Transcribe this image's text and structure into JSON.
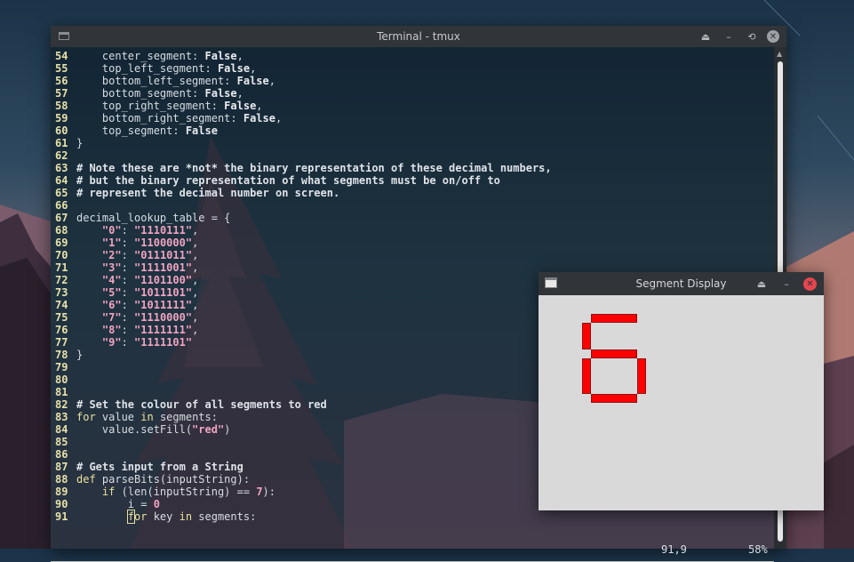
{
  "terminal": {
    "title": "Terminal - tmux",
    "controls": {
      "shade": "⏏",
      "minimize": "–",
      "maximize": "⟲",
      "close": "✕"
    },
    "lines": [
      {
        "n": "54",
        "html": "    center_segment: <span class='bool'>False</span>,"
      },
      {
        "n": "55",
        "html": "    top_left_segment: <span class='bool'>False</span>,"
      },
      {
        "n": "56",
        "html": "    bottom_left_segment: <span class='bool'>False</span>,"
      },
      {
        "n": "57",
        "html": "    bottom_segment: <span class='bool'>False</span>,"
      },
      {
        "n": "58",
        "html": "    top_right_segment: <span class='bool'>False</span>,"
      },
      {
        "n": "59",
        "html": "    bottom_right_segment: <span class='bool'>False</span>,"
      },
      {
        "n": "60",
        "html": "    top_segment: <span class='bool'>False</span>"
      },
      {
        "n": "61",
        "html": "}"
      },
      {
        "n": "62",
        "html": ""
      },
      {
        "n": "63",
        "html": "<span class='cm'># Note these are *not* the binary representation of these decimal numbers,</span>"
      },
      {
        "n": "64",
        "html": "<span class='cm'># but the binary representation of what segments must be on/off to</span>"
      },
      {
        "n": "65",
        "html": "<span class='cm'># represent the decimal number on screen.</span>"
      },
      {
        "n": "66",
        "html": ""
      },
      {
        "n": "67",
        "html": "decimal_lookup_table = {"
      },
      {
        "n": "68",
        "html": "    <span class='str'>\"0\"</span>: <span class='str'>\"1110111\"</span>,"
      },
      {
        "n": "69",
        "html": "    <span class='str'>\"1\"</span>: <span class='str'>\"1100000\"</span>,"
      },
      {
        "n": "70",
        "html": "    <span class='str'>\"2\"</span>: <span class='str'>\"0111011\"</span>,"
      },
      {
        "n": "71",
        "html": "    <span class='str'>\"3\"</span>: <span class='str'>\"1111001\"</span>,"
      },
      {
        "n": "72",
        "html": "    <span class='str'>\"4\"</span>: <span class='str'>\"1101100\"</span>,"
      },
      {
        "n": "73",
        "html": "    <span class='str'>\"5\"</span>: <span class='str'>\"1011101\"</span>,"
      },
      {
        "n": "74",
        "html": "    <span class='str'>\"6\"</span>: <span class='str'>\"1011111\"</span>,"
      },
      {
        "n": "75",
        "html": "    <span class='str'>\"7\"</span>: <span class='str'>\"1110000\"</span>,"
      },
      {
        "n": "76",
        "html": "    <span class='str'>\"8\"</span>: <span class='str'>\"1111111\"</span>,"
      },
      {
        "n": "77",
        "html": "    <span class='str'>\"9\"</span>: <span class='str'>\"1111101\"</span>"
      },
      {
        "n": "78",
        "html": "}"
      },
      {
        "n": "79",
        "html": ""
      },
      {
        "n": "80",
        "html": ""
      },
      {
        "n": "81",
        "html": ""
      },
      {
        "n": "82",
        "html": "<span class='cm'># Set the colour of all segments to red</span>"
      },
      {
        "n": "83",
        "html": "<span class='kw'>for</span> value <span class='kw'>in</span> segments:"
      },
      {
        "n": "84",
        "html": "    value.setFill(<span class='str'>\"red\"</span>)"
      },
      {
        "n": "85",
        "html": ""
      },
      {
        "n": "86",
        "html": ""
      },
      {
        "n": "87",
        "html": "<span class='cm'># Gets input from a String</span>"
      },
      {
        "n": "88",
        "html": "<span class='kw'>def</span> parseBits(inputString):"
      },
      {
        "n": "89",
        "html": "    <span class='kw'>if</span> (len(inputString) == <span class='num'>7</span>):"
      },
      {
        "n": "90",
        "html": "        i = <span class='num'>0</span>"
      },
      {
        "n": "91",
        "html": "        <span class='kw cursor'>f</span><span class='kw'>or</span> key <span class='kw'>in</span> segments:"
      }
    ],
    "status": {
      "position": "91,9",
      "percent": "58%"
    }
  },
  "segment_display": {
    "title": "Segment Display",
    "controls": {
      "shade": "⏏",
      "minimize": "–",
      "close": "✕"
    },
    "digit_shown": "6",
    "segment_color": "#ff0000"
  }
}
